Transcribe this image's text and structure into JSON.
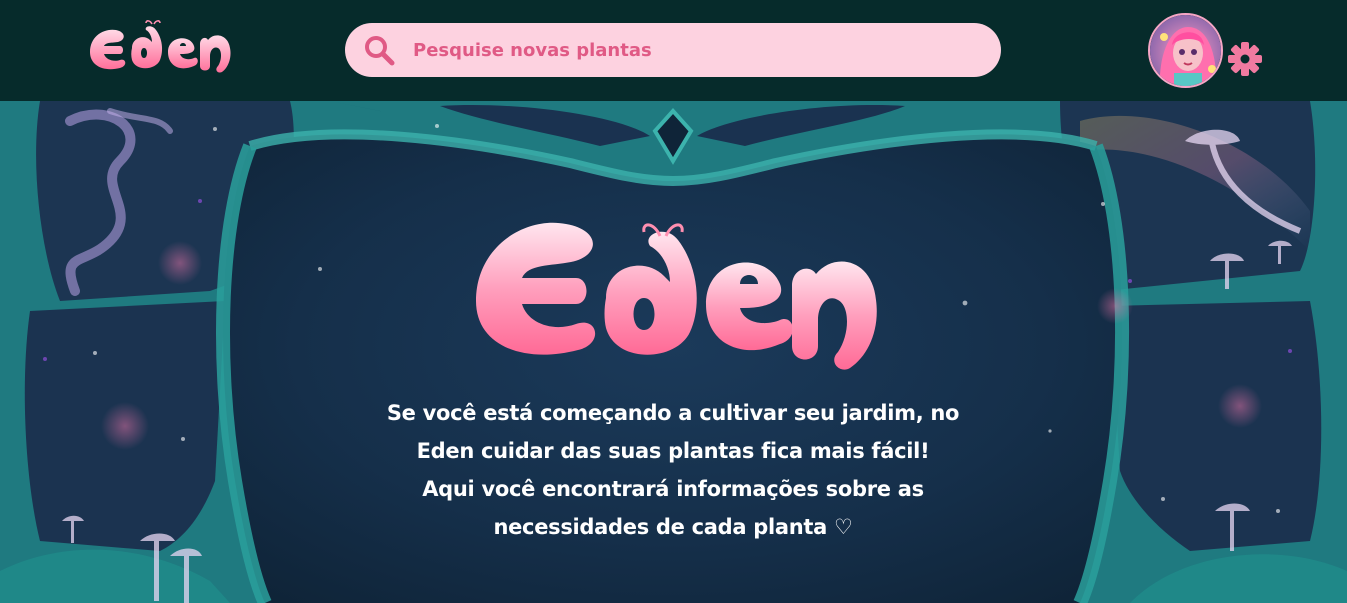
{
  "app": {
    "brand": "Eden"
  },
  "header": {
    "search": {
      "placeholder": "Pesquise novas plantas",
      "value": ""
    },
    "avatar_icon": "user-avatar",
    "settings_icon": "gear-icon"
  },
  "hero": {
    "logo_text": "Eden",
    "tagline_lines": [
      "Se você está começando a cultivar seu jardim, no",
      "Eden cuidar das suas plantas fica mais fácil!",
      "Aqui você encontrará informações sobre as",
      "necessidades de cada planta ♡"
    ]
  },
  "colors": {
    "header_bg": "#062b2b",
    "search_bg": "#fdd2e0",
    "accent_pink": "#e05a85",
    "logo_pink": "#ff7aa2",
    "hero_frame_teal": "#2a8a8a",
    "hero_sky": "#14304a"
  }
}
